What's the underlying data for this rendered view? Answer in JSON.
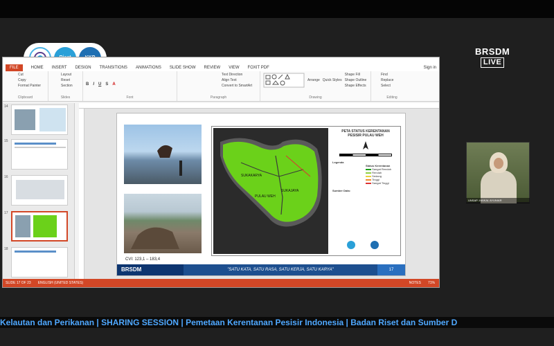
{
  "stream": {
    "channel_name": "BRSDM",
    "live_label": "LIVE",
    "ticker": "Kelautan dan Perikanan | SHARING SESSION | Pemetaan Kerentanan Pesisir Indonesia | Badan Riset dan Sumber D"
  },
  "badges": [
    "",
    "Riset",
    "KKP"
  ],
  "ppt": {
    "tabs": [
      "FILE",
      "HOME",
      "INSERT",
      "DESIGN",
      "TRANSITIONS",
      "ANIMATIONS",
      "SLIDE SHOW",
      "REVIEW",
      "VIEW",
      "FOXIT PDF"
    ],
    "sign_in": "Sign in",
    "ribbon_groups": [
      "Clipboard",
      "Slides",
      "Font",
      "Paragraph",
      "Drawing",
      "Editing"
    ],
    "clipboard_items": [
      "Cut",
      "Copy",
      "Format Painter"
    ],
    "slides_items": [
      "Layout",
      "Reset",
      "Section"
    ],
    "drawing_items": [
      "Arrange",
      "Quick Styles",
      "Shape Fill",
      "Shape Outline",
      "Shape Effects"
    ],
    "editing_items": [
      "Find",
      "Replace",
      "Select"
    ],
    "paragraph_items": [
      "Text Direction",
      "Align Text",
      "Convert to SmartArt"
    ],
    "thumb_numbers": [
      "14",
      "15",
      "16",
      "17",
      "18"
    ],
    "status_left": "SLIDE 17 OF 23",
    "status_lang": "ENGLISH (UNITED STATES)",
    "status_notes": "NOTES",
    "status_zoom": "71%"
  },
  "slide": {
    "cvi_text": "CVI: 123,1 – 183,4",
    "map_title": "PETA STATUS KERENTANAN",
    "map_subtitle": "PESISIR PULAU WEH",
    "legend_title": "Legenda",
    "legend_status": "Status Kerentanan",
    "legend_items": [
      "Sangat Rendah",
      "Rendah",
      "Sedang",
      "Tinggi",
      "Sangat Tinggi"
    ],
    "source_title": "Sumber Data:",
    "map_label_1": "SUKAKARYA",
    "map_label_2": "SUKAJAYA",
    "map_label_3": "PULAU WEH",
    "footer_brand": "BRSDM",
    "footer_slogan": "\"SATU KATA, SATU RASA, SATU KERJA, SATU KARYA\"",
    "footer_page": "17"
  },
  "webcam": {
    "label": "UNSAP: HAIKAL AYUNIAR"
  },
  "colors": {
    "ppt_accent": "#d24726",
    "footer_blue": "#1d4f8f",
    "map_land": "#6bd11a",
    "ticker_text": "#4fa8ff"
  }
}
